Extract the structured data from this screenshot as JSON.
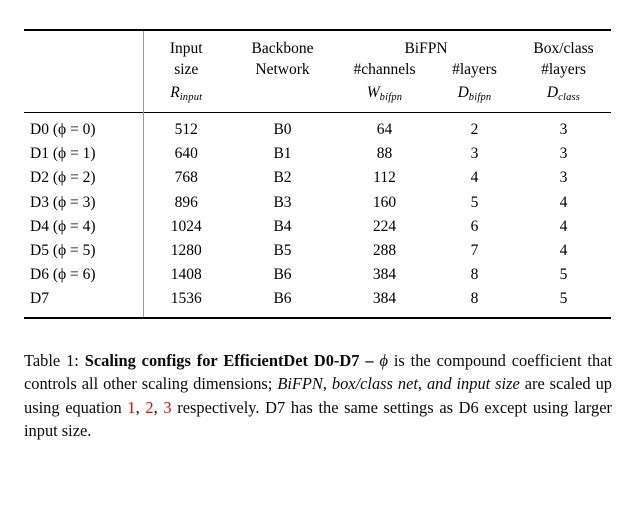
{
  "table": {
    "columns": [
      {
        "id": "model",
        "header_lines": [
          "",
          "",
          ""
        ]
      },
      {
        "id": "input",
        "header_lines": [
          "Input",
          "size",
          "R_input"
        ]
      },
      {
        "id": "backbone",
        "header_lines": [
          "Backbone",
          "Network",
          ""
        ]
      },
      {
        "id": "channels",
        "header_lines": [
          "",
          "#channels",
          "W_bifpn"
        ]
      },
      {
        "id": "layers",
        "header_lines": [
          "",
          "#layers",
          "D_bifpn"
        ]
      },
      {
        "id": "boxclass",
        "header_lines": [
          "Box/class",
          "#layers",
          "D_class"
        ]
      }
    ],
    "group_header": "BiFPN",
    "headers": {
      "input_line1": "Input",
      "input_line2": "size",
      "input_sym": "R",
      "input_sym_sub": "input",
      "backbone_line1": "Backbone",
      "backbone_line2": "Network",
      "bifpn_group": "BiFPN",
      "channels_line": "#channels",
      "channels_sym": "W",
      "channels_sym_sub": "bifpn",
      "layers_line": "#layers",
      "layers_sym": "D",
      "layers_sym_sub": "bifpn",
      "boxclass_line1": "Box/class",
      "boxclass_line2": "#layers",
      "boxclass_sym": "D",
      "boxclass_sym_sub": "class"
    },
    "rows": [
      {
        "model": "D0",
        "phi": "0",
        "input_size": "512",
        "backbone": "B0",
        "channels": "64",
        "layers": "2",
        "boxclass": "3"
      },
      {
        "model": "D1",
        "phi": "1",
        "input_size": "640",
        "backbone": "B1",
        "channels": "88",
        "layers": "3",
        "boxclass": "3"
      },
      {
        "model": "D2",
        "phi": "2",
        "input_size": "768",
        "backbone": "B2",
        "channels": "112",
        "layers": "4",
        "boxclass": "3"
      },
      {
        "model": "D3",
        "phi": "3",
        "input_size": "896",
        "backbone": "B3",
        "channels": "160",
        "layers": "5",
        "boxclass": "4"
      },
      {
        "model": "D4",
        "phi": "4",
        "input_size": "1024",
        "backbone": "B4",
        "channels": "224",
        "layers": "6",
        "boxclass": "4"
      },
      {
        "model": "D5",
        "phi": "5",
        "input_size": "1280",
        "backbone": "B5",
        "channels": "288",
        "layers": "7",
        "boxclass": "4"
      },
      {
        "model": "D6",
        "phi": "6",
        "input_size": "1408",
        "backbone": "B6",
        "channels": "384",
        "layers": "8",
        "boxclass": "5"
      },
      {
        "model": "D7",
        "phi": null,
        "input_size": "1536",
        "backbone": "B6",
        "channels": "384",
        "layers": "8",
        "boxclass": "5"
      }
    ],
    "row_labels": [
      "D0 (ϕ = 0)",
      "D1 (ϕ = 1)",
      "D2 (ϕ = 2)",
      "D3 (ϕ = 3)",
      "D4 (ϕ = 4)",
      "D5 (ϕ = 5)",
      "D6 (ϕ = 6)",
      "D7"
    ]
  },
  "caption": {
    "label": "Table 1:",
    "title": "Scaling configs for EfficientDet D0-D7 –",
    "phi_symbol": "ϕ",
    "text_part1": " is the compound coefficient that controls all other scaling dimensions; ",
    "italic_part": "BiFPN, box/class net, and input size",
    "text_part2": " are scaled up using equation ",
    "link1": "1",
    "sep1": ", ",
    "link2": "2",
    "sep2": ", ",
    "link3": "3",
    "text_part3": " respectively. D7 has the same settings as D6 except using larger input size.",
    "link_color": "#ff0000"
  }
}
